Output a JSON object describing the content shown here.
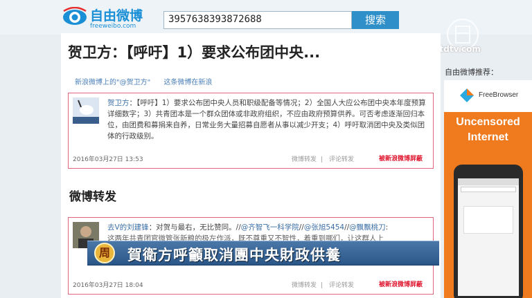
{
  "header": {
    "logo_title": "自由微博",
    "logo_subtitle": "freeweibo.com",
    "search_value": "3957638393872688",
    "search_button": "搜索"
  },
  "watermark": {
    "brand_text": "ntdtv.com"
  },
  "main": {
    "page_title": "贺卫方：【呼吁】1）要求公布团中央...",
    "links": [
      "新浪微博上的\"@贺卫方\"",
      "这条微博在新浪"
    ],
    "post": {
      "author": "贺卫方",
      "body": "：【呼吁】1）要求公布团中央人员和职级配备等情况；2）全国人大应公布团中央本年度预算详细数字；3）共青团本是一个群众团体或非政府组织，不应由政府预算供养。可否考虑逐渐回归本位，由团费和募捐来自养，日常业务大量招募自愿者从事以减少开支；4）呼吁取消团中央及类似团体的行政级别。",
      "time": "2016年03月27日 13:53",
      "actions": [
        "微博转发",
        "评论转发"
      ],
      "blocked": "被新浪微博屏蔽"
    },
    "section_title": "微博转发",
    "repost": {
      "author": "去V的刘建锋",
      "body": "：对贺与最右，无比赞同。//",
      "mentions": [
        "@齐智飞一科学院",
        "@张旭5454",
        "@飘飘桃刀"
      ],
      "line2": "这两年共青团官微管张新粮的极左作派，既不尊重又不智性，着重到哪们，让这群人上",
      "time": "2016年03月27日 18:04",
      "actions": [
        "微博转发",
        "评论转发"
      ],
      "blocked": "被新浪微博屏蔽"
    }
  },
  "sidebar": {
    "recommend_label": "自由微博推荐：",
    "ad_brand": "FreeBrowser",
    "ad_headline_1": "Uncensored",
    "ad_headline_2": "Internet"
  },
  "caption": {
    "logo_char": "周",
    "text": "賀衛方呼籲取消團中央財政供養"
  },
  "colors": {
    "accent_blue": "#2f8fc8",
    "link_blue": "#3a6ea5",
    "card_border": "#e0647a",
    "blocked_red": "#e0142c",
    "ad_orange": "#f07a1e"
  }
}
